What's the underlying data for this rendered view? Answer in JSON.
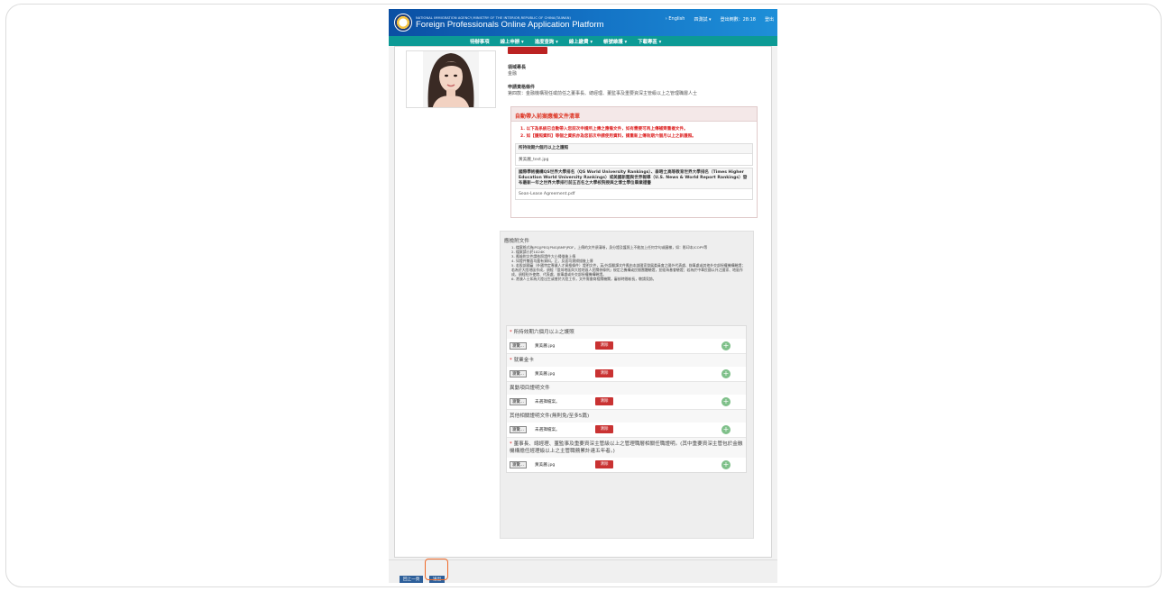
{
  "header": {
    "agency": "NATIONAL IMMIGRATION AGENCY,MINISTRY OF THE INTERIOR,REPUBLIC OF CHINA(TAIWAN)",
    "platform_title": "Foreign Professionals Online Application Platform",
    "language_link": "› English",
    "test_menu": "四測試 ▾",
    "logout_timer": "登出倒數：28:18",
    "logout": "登出"
  },
  "nav": [
    "待辦事項",
    "線上申辦 ▾",
    "進度查詢 ▾",
    "線上繳費 ▾",
    "帳號維護 ▾",
    "下載專區 ▾"
  ],
  "profile": {
    "field_label": "領域專長",
    "field_value": "金融",
    "qual_label": "申請資格條件",
    "qual_value": "第四款：金融機構現任或前任之董事長、總經理、董監事及重要資深主管級以上之管理職層人士"
  },
  "auto_docs": {
    "title": "自動帶入前案應備文件清單",
    "note1": "1. 以下為系統已自動帶入您前次申請所上傳之應備文件，如有需要可再上傳補齊重複文件。",
    "note2": "2. 如【護照資料】等個之資訊亦為您前次申請使用資料，請重新上傳效期六個月以上之新護照。",
    "items": [
      {
        "title": "所持效期六個月以上之護照",
        "file": "黃美麗_test.jpg"
      },
      {
        "title": "國際學術機構QS世界大學排名（QS World University Rankings）、泰晤士高等教育世界大學排名（Times Higher Education World University Rankings）或美國新聞與世界報導（U.S. News & World Report Rankings）發布最新一年之世界大學排行前五百名之大學校院授與之博士學位畢業證書",
        "file": "Sean-Lease Agreement.pdf"
      }
    ]
  },
  "upload": {
    "title": "應檢附文件",
    "rules": [
      "1. 檔案格式為JPG|JPEG|PNG|BMP|PDF，上傳的文件須清晰，身分證及護照上不能加上任何字句或圖樣，如：影印本/COPY等",
      "2. 檔案請小於1024K",
      "3. 應檢附文件請依照證件大小掃描後上傳",
      "4. 如證件雙面均載有資料，正、反面均需掃描後上傳",
      "5. 若股部國審（外國特定專業人才資格條件）證明文件，英/外語翻譯文件應由本部國家發展委員會之國外代表處、辦事處或其他外交部授權機構驗證；若為於大陸地區作成，須經「臺灣地區與大陸地區人民關係條例」規定之機構或民間團體驗證，並經海基會驗證；若為於中華民國以外之國家、地區作成，須經駐外使館、代表處、辦事處或外交部授權機構驗證。",
      "6. 港澳人士如為大陸出生或曾於大陸工作，文件需會商相關機關，審核時間較長，敬請見諒。"
    ],
    "browse_label": "瀏覽...",
    "clear_label": "清除",
    "items": [
      {
        "label": "所持效期六個月以上之護照",
        "required": "*",
        "file": "黃美麗.jpg"
      },
      {
        "label": "就業金卡",
        "required": "*",
        "file": "黃美麗.jpg"
      },
      {
        "label": "異動項目證明文件",
        "required": "",
        "file": "未選擇檔案。"
      },
      {
        "label": "其他相關證明文件(無則免/至多5篇)",
        "required": "",
        "file": "未選擇檔案。"
      },
      {
        "label": "董事長、總經理、董監事及重要資深主管級以上之管理職層相關任職證明。(其中重要資深主管包於金融機構擔任經理級以上之主管職務累計達五年者。)",
        "required": "*",
        "file": "黃美麗.jpg"
      }
    ]
  },
  "footer": {
    "prev": "回上一頁",
    "submit": "送出"
  }
}
